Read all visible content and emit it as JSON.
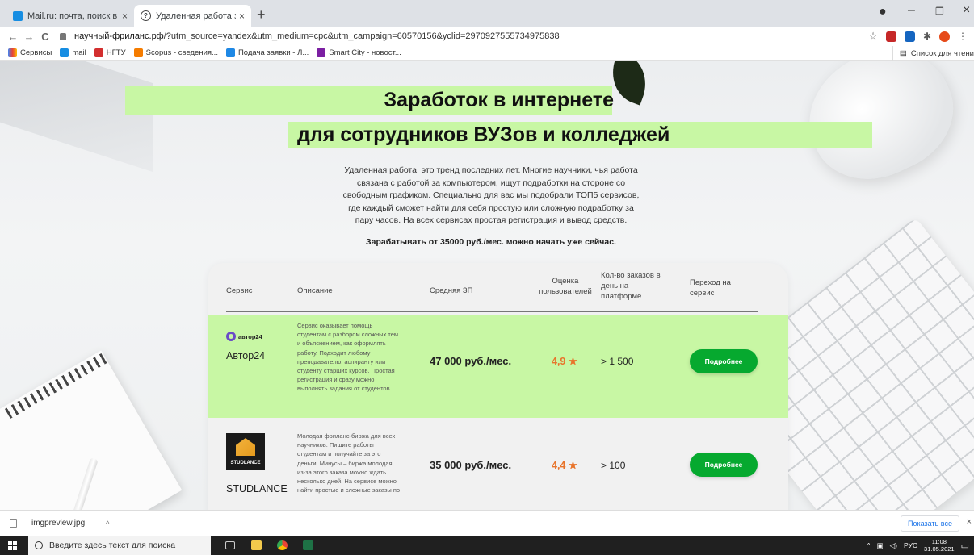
{
  "browser": {
    "tabs": [
      {
        "title": "Mail.ru: почта, поиск в интерне",
        "close": "×"
      },
      {
        "title": "Удаленная работа за компьюте",
        "close": "×"
      }
    ],
    "new_tab": "+",
    "window_controls": [
      "–",
      "❐",
      "×"
    ],
    "nav": {
      "back": "←",
      "forward": "→",
      "reload": "C"
    },
    "url_host": "научный-фриланс.рф",
    "url_path": "/?utm_source=yandex&utm_medium=cpc&utm_campaign=60570156&yclid=2970927555734975838",
    "star": "☆",
    "bookmarks": [
      "Сервисы",
      "mail",
      "НГТУ",
      "Scopus - сведения...",
      "Подача заявки - Л...",
      "Smart City - новост..."
    ],
    "reading_list": "Список для чтени"
  },
  "hero": {
    "title_line1": "Заработок в интернете",
    "title_line2": "для сотрудников ВУЗов и колледжей",
    "intro": "Удаленная работа, это тренд последних лет. Многие научники, чья работа связана с работой за компьютером, ищут подработки на стороне со свободным графиком. Специально для вас мы подобрали ТОП5 сервисов, где каждый сможет найти для себя простую или сложную подработку за пару часов. На всех сервисах простая регистрация и вывод средств.",
    "intro_strong": "Зарабатывать от 35000 руб./мес. можно начать уже сейчас."
  },
  "table": {
    "headers": {
      "service": "Сервис",
      "description": "Описание",
      "salary": "Средняя ЗП",
      "rating": "Оценка пользователей",
      "orders": "Кол-во заказов в день на платформе",
      "link": "Переход на сервис"
    },
    "rows": [
      {
        "logo_text": "автор24",
        "name": "Автор24",
        "description": "Сервис оказывает помощь студентам с разбором сложных тем и объяснением, как оформлять работу. Подходит любому преподавателю, аспиранту или студенту старших курсов. Простая регистрация и сразу можно выполнять задания от студентов.",
        "salary": "47 000 руб./мес.",
        "rating": "4,9 ★",
        "orders": "> 1 500",
        "button": "Подробнее"
      },
      {
        "logo_text": "STUDLANCE",
        "name": "STUDLANCE",
        "description": "Молодая фриланс-биржа для всех научников. Пишите работы студентам и получайте за это деньги. Минусы – биржа молодая, из-за этого заказа можно ждать несколько дней. На сервисе можно найти простые и сложные заказы по",
        "salary": "35 000 руб./мес.",
        "rating": "4,4 ★",
        "orders": "> 100",
        "button": "Подробнее"
      }
    ]
  },
  "download_bar": {
    "file": "imgpreview.jpg",
    "chevron": "^",
    "show_all": "Показать все",
    "close": "×"
  },
  "taskbar": {
    "search_placeholder": "Введите здесь текст для поиска",
    "lang": "РУС",
    "time": "11:08",
    "date": "31.05.2021"
  },
  "colors": {
    "accent_green": "#c8f7a4",
    "button_green": "#06a92f",
    "rating_orange": "#e8742b"
  }
}
